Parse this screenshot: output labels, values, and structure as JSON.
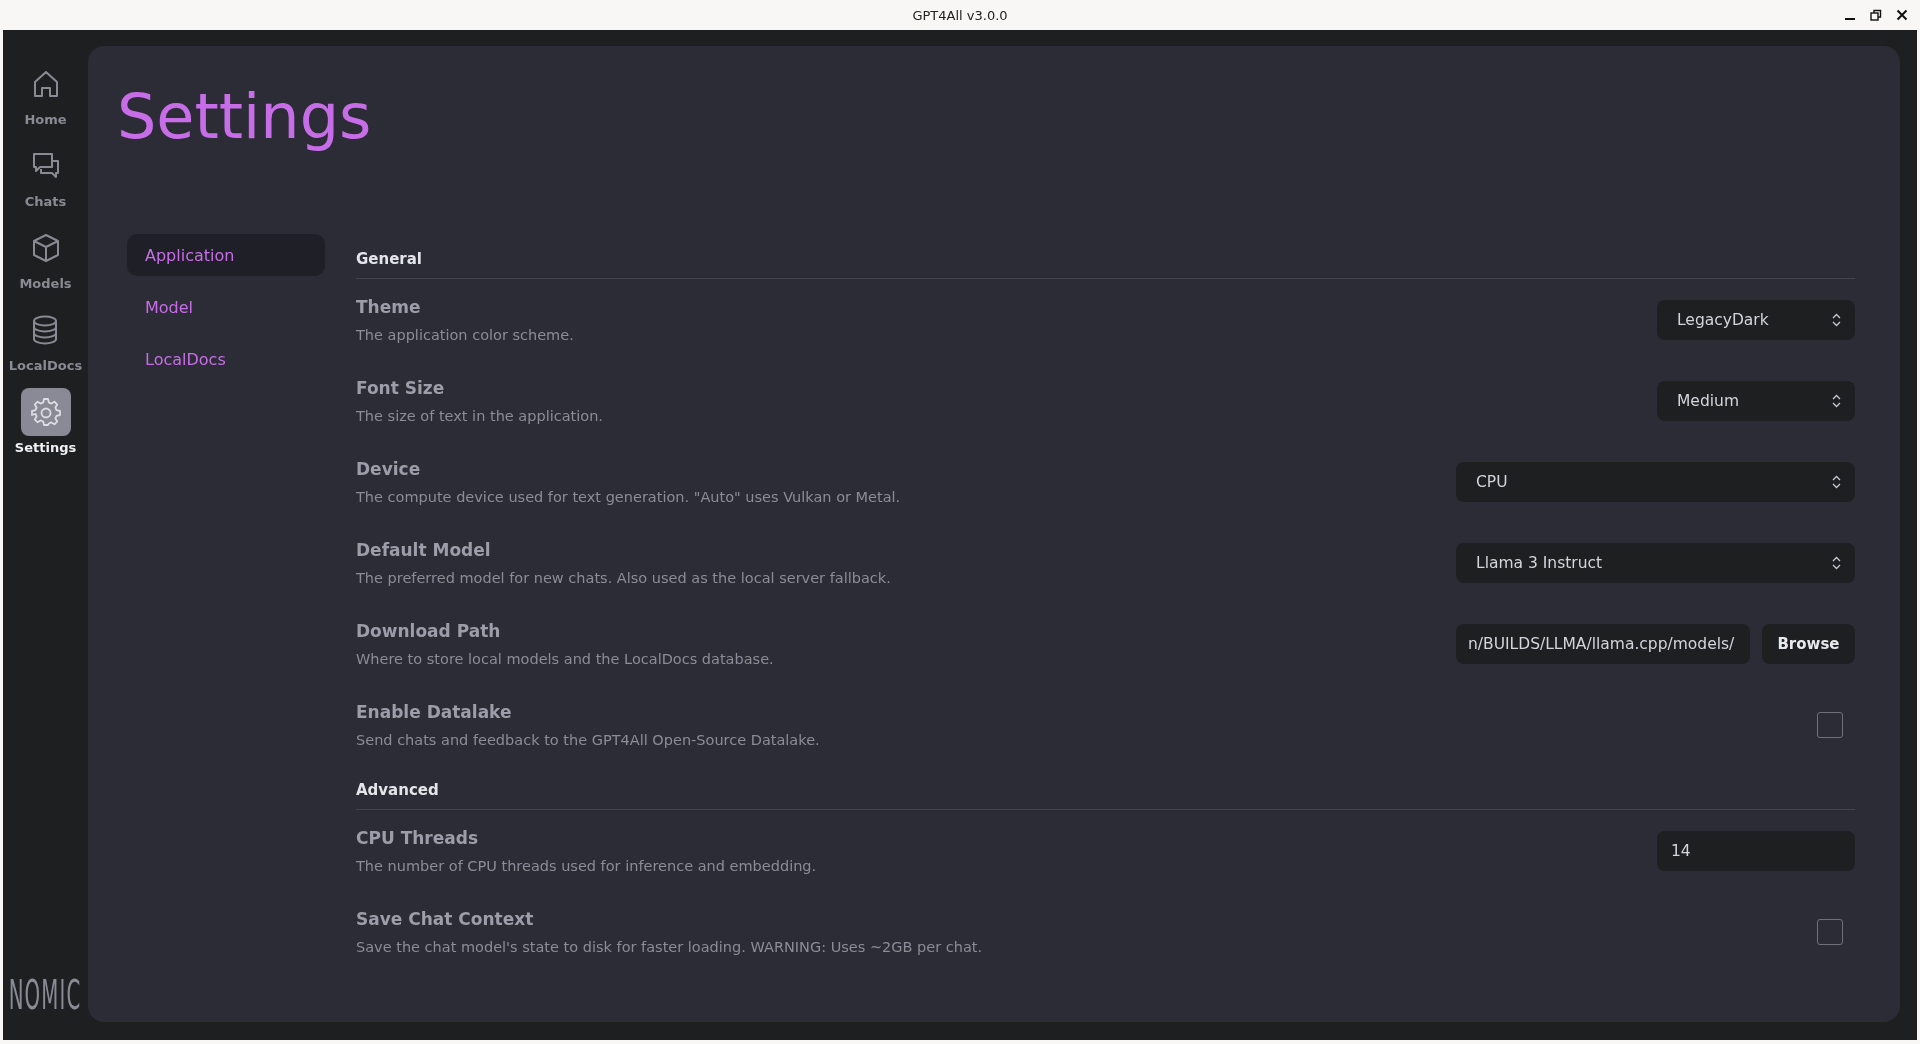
{
  "window": {
    "title": "GPT4All v3.0.0"
  },
  "nav": [
    {
      "label": "Home",
      "selected": false
    },
    {
      "label": "Chats",
      "selected": false
    },
    {
      "label": "Models",
      "selected": false
    },
    {
      "label": "LocalDocs",
      "selected": false
    },
    {
      "label": "Settings",
      "selected": true
    }
  ],
  "logo": "NOMIC",
  "page_title": "Settings",
  "settings_tabs": [
    {
      "label": "Application",
      "selected": true
    },
    {
      "label": "Model",
      "selected": false
    },
    {
      "label": "LocalDocs",
      "selected": false
    }
  ],
  "sections": [
    {
      "title": "General",
      "rows": [
        {
          "kind": "combo",
          "label": "Theme",
          "description": "The application color scheme.",
          "value": "LegacyDark",
          "wide": false
        },
        {
          "kind": "combo",
          "label": "Font Size",
          "description": "The size of text in the application.",
          "value": "Medium",
          "wide": false
        },
        {
          "kind": "combo",
          "label": "Device",
          "description": "The compute device used for text generation. \"Auto\" uses Vulkan or Metal.",
          "value": "CPU",
          "wide": true
        },
        {
          "kind": "combo",
          "label": "Default Model",
          "description": "The preferred model for new chats. Also used as the local server fallback.",
          "value": "Llama 3 Instruct",
          "wide": true
        },
        {
          "kind": "path",
          "label": "Download Path",
          "description": "Where to store local models and the LocalDocs database.",
          "value": "n/BUILDS/LLMA/llama.cpp/models/",
          "button": "Browse"
        },
        {
          "kind": "checkbox",
          "label": "Enable Datalake",
          "description": "Send chats and feedback to the GPT4All Open-Source Datalake.",
          "checked": false
        }
      ]
    },
    {
      "title": "Advanced",
      "rows": [
        {
          "kind": "number",
          "label": "CPU Threads",
          "description": "The number of CPU threads used for inference and embedding.",
          "value": "14"
        },
        {
          "kind": "checkbox",
          "label": "Save Chat Context",
          "description": "Save the chat model's state to disk for faster loading. WARNING: Uses ~2GB per chat.",
          "checked": false
        }
      ]
    }
  ]
}
